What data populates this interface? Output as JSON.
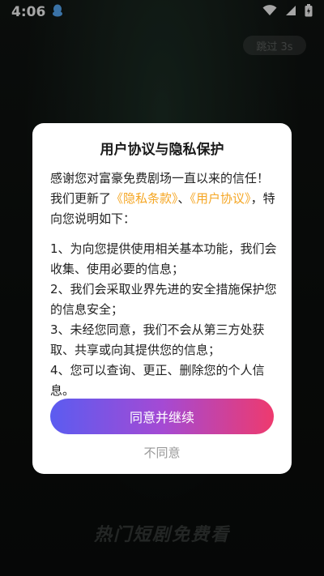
{
  "status_bar": {
    "time": "4:06"
  },
  "background": {
    "skip_label": "跳过 3s",
    "slogan": "热门短剧免费看"
  },
  "dialog": {
    "title": "用户协议与隐私保护",
    "intro_prefix": "感谢您对富豪免费剧场一直以来的信任！我们更新了",
    "privacy_link": "《隐私条款》",
    "separator": "、",
    "user_link": "《用户协议》",
    "intro_suffix": "，特向您说明如下：",
    "items": [
      "1、为向您提供使用相关基本功能，我们会收集、使用必要的信息；",
      "2、我们会采取业界先进的安全措施保护您的信息安全；",
      "3、未经您同意，我们不会从第三方处获取、共享或向其提供您的信息；",
      "4、您可以查询、更正、删除您的个人信息。"
    ],
    "agree_label": "同意并继续",
    "disagree_label": "不同意"
  },
  "colors": {
    "accent": "#f5a623",
    "gradient_start": "#5b5cf0",
    "gradient_end": "#ee3a6e"
  },
  "icons": [
    "qq-notification-icon",
    "wifi-icon",
    "signal-icon",
    "battery-icon"
  ]
}
